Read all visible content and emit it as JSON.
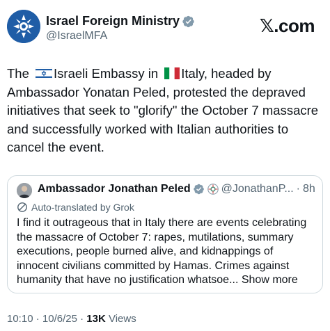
{
  "brand": "𝕏.com",
  "author": {
    "display_name": "Israel Foreign Ministry",
    "handle": "@IsraelMFA"
  },
  "tweet": {
    "text_parts": [
      "The ",
      "Israeli Embassy in ",
      "Italy, headed by Ambassador Yonatan Peled, protested the depraved initiatives that seek to \"glorify\" the October 7 massacre and successfully worked with Italian authorities to cancel the event."
    ]
  },
  "quote": {
    "display_name": "Ambassador Jonathan Peled",
    "handle": "@JonathanP...",
    "separator": "·",
    "time": "8h",
    "translated_label": "Auto-translated by Grok",
    "text": "I find it outrageous that in Italy there are events celebrating the massacre of October 7: rapes, mutilations, summary executions, people burned alive, and kidnappings of innocent civilians committed by Hamas. Crimes against humanity that have no justification whatsoe...",
    "show_more": "Show more"
  },
  "meta": {
    "time": "10:10",
    "sep1": " · ",
    "date": "10/6/25",
    "sep2": " · ",
    "views_count": "13K",
    "views_label": " Views"
  },
  "colors": {
    "verified_gray": "#829aab",
    "mfa_blue": "#1f5da6",
    "text": "#0f1419",
    "secondary": "#536471"
  }
}
